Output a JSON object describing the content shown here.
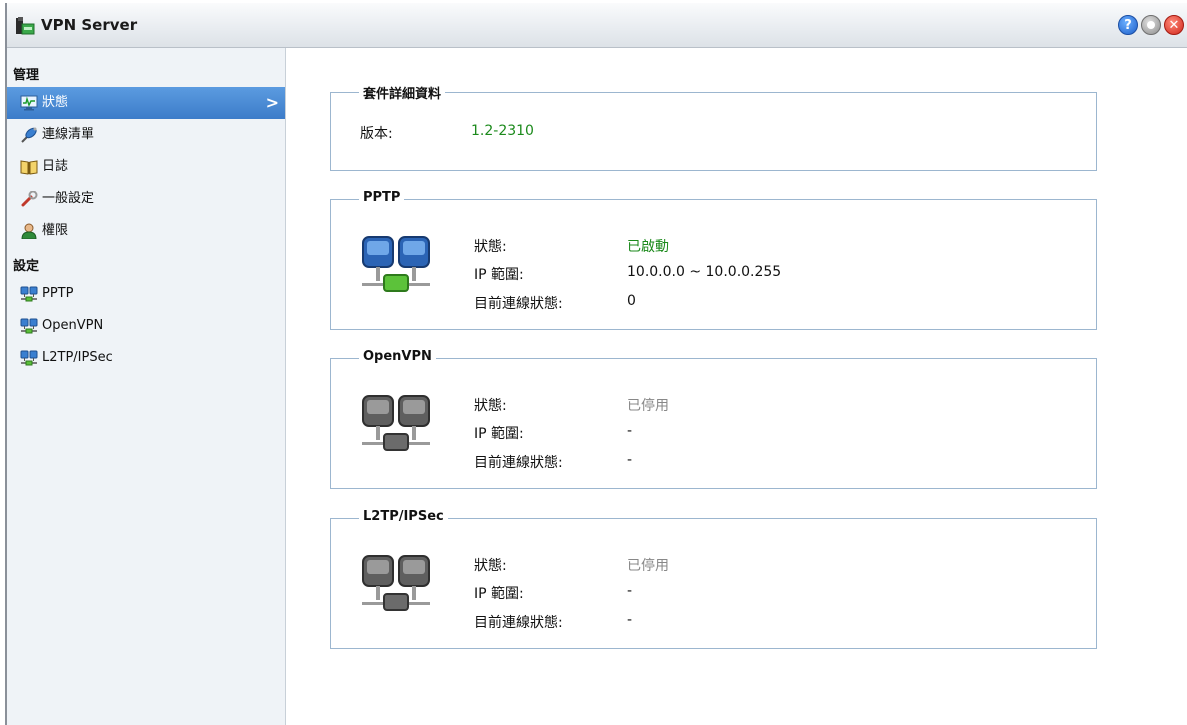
{
  "window": {
    "title": "VPN Server"
  },
  "titlebar_buttons": {
    "help": "?"
  },
  "sidebar": {
    "sections": [
      {
        "title": "管理",
        "items": [
          {
            "label": "狀態",
            "icon": "monitor-icon",
            "active": true
          },
          {
            "label": "連線清單",
            "icon": "satellite-icon"
          },
          {
            "label": "日誌",
            "icon": "book-icon"
          },
          {
            "label": "一般設定",
            "icon": "wrench-icon"
          },
          {
            "label": "權限",
            "icon": "user-icon"
          }
        ]
      },
      {
        "title": "設定",
        "items": [
          {
            "label": "PPTP",
            "icon": "network-icon"
          },
          {
            "label": "OpenVPN",
            "icon": "network-icon"
          },
          {
            "label": "L2TP/IPSec",
            "icon": "network-icon"
          }
        ]
      }
    ]
  },
  "package": {
    "legend": "套件詳細資料",
    "version_label": "版本:",
    "version_value": "1.2-2310"
  },
  "services": [
    {
      "legend": "PPTP",
      "status_label": "狀態:",
      "status_value": "已啟動",
      "range_label": "IP 範圍:",
      "range_value": "10.0.0.0 ~ 10.0.0.255",
      "conn_label": "目前連線狀態:",
      "conn_value": "0",
      "enabled": true
    },
    {
      "legend": "OpenVPN",
      "status_label": "狀態:",
      "status_value": "已停用",
      "range_label": "IP 範圍:",
      "range_value": "-",
      "conn_label": "目前連線狀態:",
      "conn_value": "-",
      "enabled": false
    },
    {
      "legend": "L2TP/IPSec",
      "status_label": "狀態:",
      "status_value": "已停用",
      "range_label": "IP 範圍:",
      "range_value": "-",
      "conn_label": "目前連線狀態:",
      "conn_value": "-",
      "enabled": false
    }
  ],
  "colors": {
    "accent": "#3c7cc9",
    "enabled_text": "#1c8a1c",
    "disabled_text": "#888888",
    "group_border": "#9cb6cf"
  }
}
